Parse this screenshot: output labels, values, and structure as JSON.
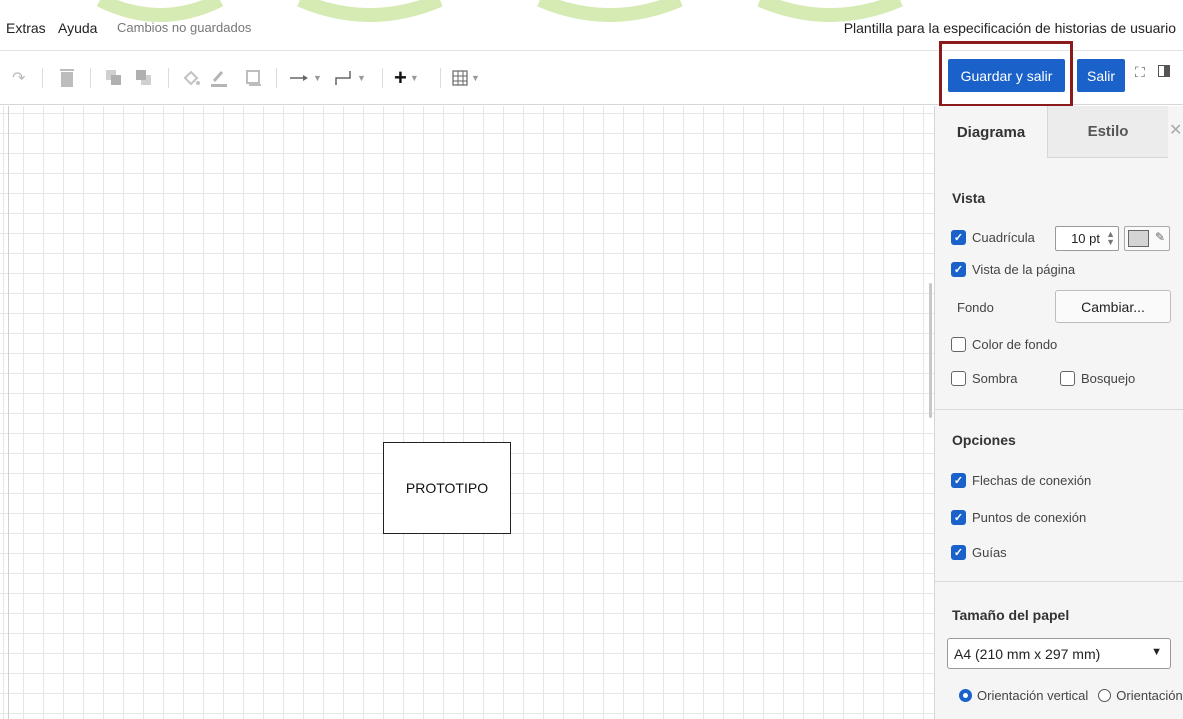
{
  "menu": {
    "extras": "Extras",
    "ayuda": "Ayuda",
    "status": "Cambios no guardados",
    "doc_title": "Plantilla para la especificación de historias de usuario"
  },
  "toolbar": {
    "icons": [
      "redo-icon",
      "delete-icon",
      "to-front-icon",
      "to-back-icon",
      "fill-color-icon",
      "line-color-icon",
      "shadow-icon",
      "connection-icon",
      "waypoints-icon",
      "insert-icon",
      "table-icon"
    ],
    "guardar_label": "Guardar y salir",
    "salir_label": "Salir"
  },
  "canvas": {
    "shape_label": "PROTOTIPO"
  },
  "panel": {
    "tabs": [
      {
        "label": "Diagrama",
        "active": true
      },
      {
        "label": "Estilo",
        "active": false
      }
    ],
    "vista": {
      "title": "Vista",
      "cuadricula": {
        "label": "Cuadrícula",
        "checked": true,
        "size": "10 pt"
      },
      "vista_pagina": {
        "label": "Vista de la página",
        "checked": true
      },
      "fondo_label": "Fondo",
      "cambiar_label": "Cambiar...",
      "color_fondo": {
        "label": "Color de fondo",
        "checked": false
      },
      "sombra": {
        "label": "Sombra",
        "checked": false
      },
      "bosquejo": {
        "label": "Bosquejo",
        "checked": false
      }
    },
    "opciones": {
      "title": "Opciones",
      "flechas": {
        "label": "Flechas de conexión",
        "checked": true
      },
      "puntos": {
        "label": "Puntos de conexión",
        "checked": true
      },
      "guias": {
        "label": "Guías",
        "checked": true
      }
    },
    "papel": {
      "title": "Tamaño del papel",
      "selected": "A4 (210 mm x 297 mm)",
      "vertical": "Orientación vertical",
      "horizontal": "Orientación"
    }
  },
  "colors": {
    "accent": "#1a62c9",
    "highlight": "#8b1a1a"
  }
}
